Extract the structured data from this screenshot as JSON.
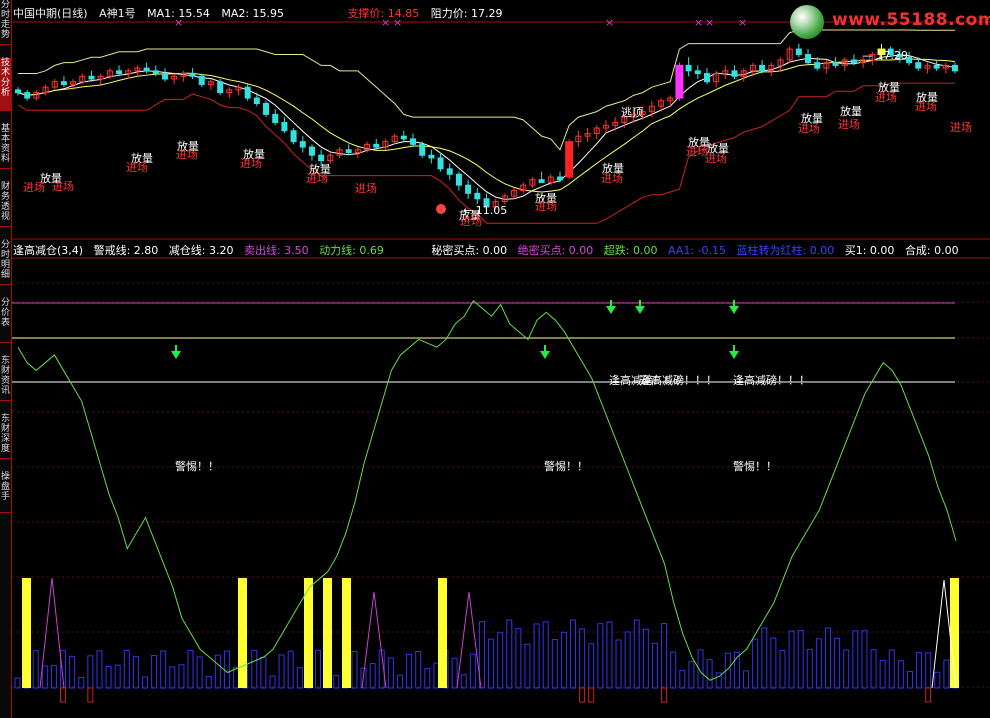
{
  "side_tabs": [
    "分时走势",
    "技术分析",
    "基本资料",
    "财务透视",
    "分时明细",
    "分价表",
    "东财资讯",
    "东财深度",
    "操盘手"
  ],
  "active_tab": 1,
  "main_header": {
    "stock": "中国中期(日线)",
    "formula": "A神1号",
    "ma1": "MA1: 15.54",
    "ma2": "MA2: 15.95",
    "support": "支撑价: 14.85",
    "resistance": "阻力价: 17.29"
  },
  "indicator_header": {
    "name": "逢高减仓(3,4)",
    "warn": "警戒线: 2.80",
    "reduce": "减仓线: 3.20",
    "sell": "卖出线: 3.50",
    "power": "动力线: 0.69",
    "secret_buy": "秘密买点: 0.00",
    "absolute_buy": "绝密买点: 0.00",
    "super_drop": "超跌: 0.00",
    "aa1": "AA1: -0.15",
    "blue_to_red": "蓝柱转为红柱: 0.00",
    "buy1": "买1: 0.00",
    "composite": "合成: 0.00"
  },
  "watermark": "www.55188.com",
  "colors": {
    "up": "#ff3333",
    "down": "#33e0e0",
    "ma": "#ffffff",
    "upper_band": "#e8e890",
    "lower_band": "#cc2222",
    "power_line": "#66dd44",
    "sell_line": "#cc44cc",
    "reduce_line": "#ffff88",
    "warn_line": "#ffffff",
    "yellow_bar": "#ffff33",
    "blue_bar": "#3333ee",
    "magenta": "#cc44cc",
    "text_white": "#ffffff"
  },
  "price_labels": {
    "high": "17.29",
    "low": "11.05"
  },
  "annotations": {
    "fangliang": "放量",
    "jinchang": "进场",
    "taoding": "逃顶",
    "jingti": "警惕！！",
    "fenggao": "逢高减磅！！！"
  },
  "chart_data": {
    "type": "candlestick",
    "candles": [
      [
        15.6,
        15.7,
        15.4,
        15.5
      ],
      [
        15.5,
        15.6,
        15.2,
        15.3
      ],
      [
        15.3,
        15.6,
        15.2,
        15.5
      ],
      [
        15.5,
        15.8,
        15.4,
        15.7
      ],
      [
        15.7,
        16.0,
        15.6,
        15.9
      ],
      [
        15.9,
        16.1,
        15.7,
        15.8
      ],
      [
        15.8,
        16.0,
        15.6,
        15.9
      ],
      [
        15.9,
        16.2,
        15.8,
        16.1
      ],
      [
        16.1,
        16.3,
        15.9,
        16.0
      ],
      [
        16.0,
        16.2,
        15.8,
        16.1
      ],
      [
        16.1,
        16.4,
        16.0,
        16.3
      ],
      [
        16.3,
        16.5,
        16.1,
        16.2
      ],
      [
        16.2,
        16.4,
        16.0,
        16.3
      ],
      [
        16.3,
        16.5,
        16.1,
        16.4
      ],
      [
        16.4,
        16.6,
        16.2,
        16.3
      ],
      [
        16.3,
        16.5,
        16.1,
        16.2
      ],
      [
        16.2,
        16.4,
        15.9,
        16.0
      ],
      [
        16.0,
        16.2,
        15.8,
        16.1
      ],
      [
        16.1,
        16.3,
        15.9,
        16.2
      ],
      [
        16.2,
        16.4,
        16.0,
        16.1
      ],
      [
        16.1,
        16.2,
        15.7,
        15.8
      ],
      [
        15.8,
        16.0,
        15.6,
        15.9
      ],
      [
        15.9,
        16.0,
        15.4,
        15.5
      ],
      [
        15.5,
        15.7,
        15.3,
        15.6
      ],
      [
        15.6,
        15.8,
        15.4,
        15.7
      ],
      [
        15.7,
        15.8,
        15.2,
        15.3
      ],
      [
        15.3,
        15.5,
        15.0,
        15.1
      ],
      [
        15.1,
        15.2,
        14.6,
        14.7
      ],
      [
        14.7,
        14.9,
        14.3,
        14.4
      ],
      [
        14.4,
        14.6,
        14.0,
        14.1
      ],
      [
        14.1,
        14.2,
        13.6,
        13.7
      ],
      [
        13.7,
        13.9,
        13.3,
        13.5
      ],
      [
        13.5,
        13.6,
        13.0,
        13.2
      ],
      [
        13.2,
        13.4,
        12.8,
        13.0
      ],
      [
        13.0,
        13.3,
        12.9,
        13.2
      ],
      [
        13.2,
        13.5,
        13.1,
        13.4
      ],
      [
        13.4,
        13.6,
        13.2,
        13.3
      ],
      [
        13.3,
        13.5,
        13.1,
        13.4
      ],
      [
        13.4,
        13.7,
        13.3,
        13.6
      ],
      [
        13.6,
        13.8,
        13.4,
        13.5
      ],
      [
        13.5,
        13.8,
        13.4,
        13.7
      ],
      [
        13.7,
        14.0,
        13.6,
        13.9
      ],
      [
        13.9,
        14.1,
        13.7,
        13.8
      ],
      [
        13.8,
        14.0,
        13.5,
        13.6
      ],
      [
        13.6,
        13.7,
        13.1,
        13.2
      ],
      [
        13.2,
        13.4,
        12.9,
        13.1
      ],
      [
        13.1,
        13.3,
        12.6,
        12.7
      ],
      [
        12.7,
        12.9,
        12.3,
        12.5
      ],
      [
        12.5,
        12.6,
        11.9,
        12.1
      ],
      [
        12.1,
        12.3,
        11.6,
        11.8
      ],
      [
        11.8,
        12.0,
        11.4,
        11.6
      ],
      [
        11.6,
        11.8,
        11.05,
        11.3
      ],
      [
        11.3,
        11.6,
        11.2,
        11.5
      ],
      [
        11.5,
        11.8,
        11.4,
        11.7
      ],
      [
        11.7,
        12.0,
        11.6,
        11.9
      ],
      [
        11.9,
        12.2,
        11.8,
        12.1
      ],
      [
        12.1,
        12.4,
        12.0,
        12.3
      ],
      [
        12.3,
        12.6,
        12.2,
        12.2
      ],
      [
        12.2,
        12.5,
        12.1,
        12.4
      ],
      [
        12.4,
        12.6,
        12.2,
        12.3
      ],
      [
        12.4,
        13.8,
        12.3,
        13.7
      ],
      [
        13.7,
        14.1,
        13.5,
        13.9
      ],
      [
        13.9,
        14.2,
        13.7,
        14.0
      ],
      [
        14.0,
        14.3,
        13.8,
        14.2
      ],
      [
        14.2,
        14.5,
        14.0,
        14.3
      ],
      [
        14.3,
        14.6,
        14.1,
        14.4
      ],
      [
        14.4,
        14.7,
        14.2,
        14.6
      ],
      [
        14.6,
        14.9,
        14.4,
        14.7
      ],
      [
        14.7,
        15.0,
        14.5,
        14.8
      ],
      [
        14.8,
        15.2,
        14.6,
        15.0
      ],
      [
        15.0,
        15.3,
        14.8,
        15.2
      ],
      [
        15.2,
        15.4,
        15.0,
        15.3
      ],
      [
        15.3,
        16.6,
        15.2,
        16.5
      ],
      [
        16.5,
        16.8,
        16.1,
        16.3
      ],
      [
        16.3,
        16.5,
        16.0,
        16.2
      ],
      [
        16.2,
        16.4,
        15.8,
        15.9
      ],
      [
        15.9,
        16.3,
        15.7,
        16.2
      ],
      [
        16.2,
        16.5,
        16.0,
        16.3
      ],
      [
        16.3,
        16.5,
        16.0,
        16.1
      ],
      [
        16.1,
        16.4,
        15.9,
        16.3
      ],
      [
        16.3,
        16.6,
        16.1,
        16.5
      ],
      [
        16.5,
        16.7,
        16.2,
        16.3
      ],
      [
        16.3,
        16.6,
        16.1,
        16.5
      ],
      [
        16.5,
        16.8,
        16.3,
        16.7
      ],
      [
        16.7,
        17.2,
        16.6,
        17.1
      ],
      [
        17.1,
        17.3,
        16.8,
        16.9
      ],
      [
        16.9,
        17.1,
        16.5,
        16.6
      ],
      [
        16.6,
        16.8,
        16.3,
        16.4
      ],
      [
        16.4,
        16.7,
        16.2,
        16.6
      ],
      [
        16.6,
        16.8,
        16.4,
        16.5
      ],
      [
        16.5,
        16.8,
        16.3,
        16.7
      ],
      [
        16.7,
        16.9,
        16.5,
        16.6
      ],
      [
        16.6,
        16.8,
        16.4,
        16.7
      ],
      [
        16.7,
        17.0,
        16.5,
        16.9
      ],
      [
        16.9,
        17.29,
        16.7,
        17.1
      ],
      [
        17.1,
        17.2,
        16.8,
        16.9
      ],
      [
        16.9,
        17.1,
        16.6,
        16.8
      ],
      [
        16.8,
        17.0,
        16.5,
        16.6
      ],
      [
        16.6,
        16.8,
        16.3,
        16.4
      ],
      [
        16.4,
        16.6,
        16.2,
        16.5
      ],
      [
        16.5,
        16.7,
        16.3,
        16.4
      ],
      [
        16.4,
        16.6,
        16.2,
        16.5
      ],
      [
        16.5,
        16.6,
        16.2,
        16.3
      ]
    ],
    "power_line": [
      3.1,
      2.9,
      2.8,
      2.9,
      3.0,
      2.8,
      2.6,
      2.4,
      2.0,
      1.6,
      1.2,
      0.9,
      0.5,
      0.7,
      0.9,
      0.6,
      0.3,
      0.0,
      -0.4,
      -0.6,
      -0.8,
      -0.9,
      -1.0,
      -1.1,
      -1.05,
      -1.0,
      -0.95,
      -0.9,
      -0.8,
      -0.6,
      -0.4,
      -0.2,
      0.0,
      0.1,
      0.2,
      0.4,
      0.7,
      1.1,
      1.6,
      2.0,
      2.4,
      2.8,
      3.0,
      3.1,
      3.2,
      3.15,
      3.1,
      3.2,
      3.4,
      3.5,
      3.7,
      3.6,
      3.5,
      3.65,
      3.4,
      3.3,
      3.2,
      3.45,
      3.55,
      3.45,
      3.3,
      3.1,
      2.9,
      2.7,
      2.4,
      2.1,
      1.8,
      1.5,
      1.2,
      0.9,
      0.6,
      0.3,
      -0.2,
      -0.6,
      -0.9,
      -1.1,
      -1.2,
      -1.15,
      -1.05,
      -0.9,
      -0.8,
      -0.6,
      -0.4,
      -0.2,
      0.1,
      0.4,
      0.6,
      0.8,
      1.0,
      1.3,
      1.6,
      1.9,
      2.2,
      2.5,
      2.7,
      2.9,
      2.8,
      2.6,
      2.3,
      2.0,
      1.7,
      1.3,
      1.0,
      0.6
    ]
  }
}
